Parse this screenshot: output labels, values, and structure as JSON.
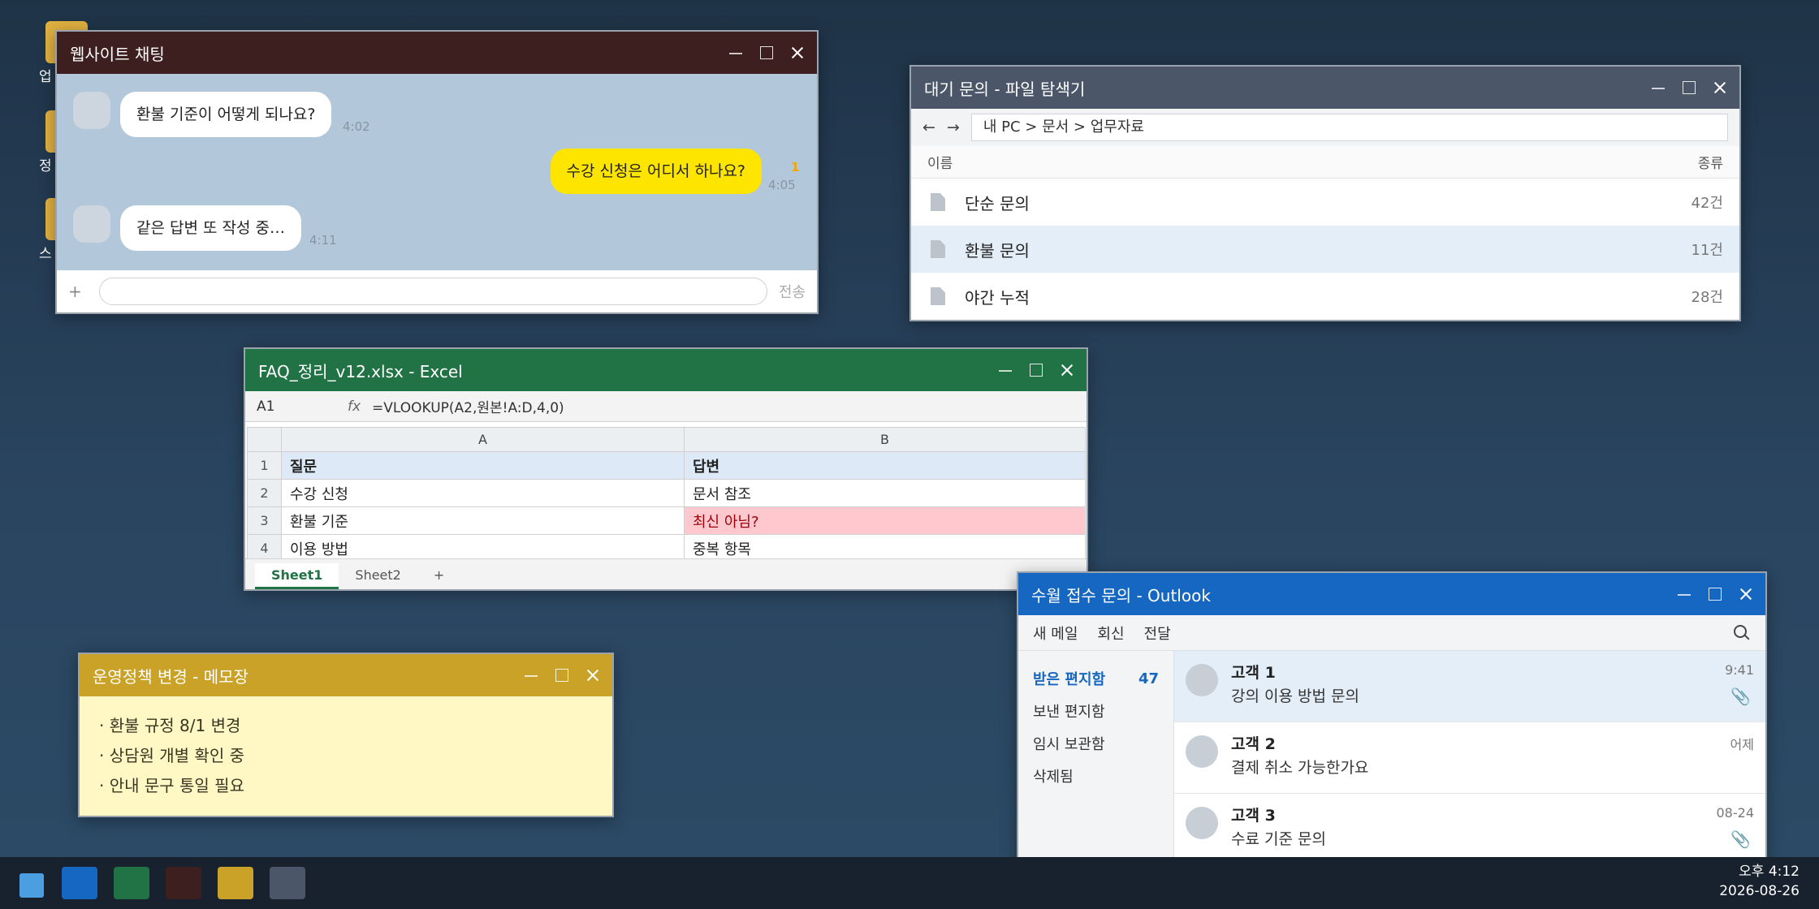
{
  "desktop": {
    "icons": [
      {
        "label": "업"
      },
      {
        "label": "정"
      },
      {
        "label": "스"
      }
    ]
  },
  "chat": {
    "title": "웹사이트 채팅",
    "messages": [
      {
        "side": "left",
        "text": "환불 기준이 어떻게 되나요?",
        "time": "4:02"
      },
      {
        "side": "right",
        "text": "수강 신청은 어디서 하나요?",
        "time": "4:05",
        "unread": "1"
      },
      {
        "side": "left",
        "text": "같은 답변 또 작성 중…",
        "time": "4:11"
      }
    ],
    "input_plus": "+",
    "send_label": "전송"
  },
  "explorer": {
    "title": "대기 문의 - 파일 탐색기",
    "back": "←",
    "forward": "→",
    "path": "내 PC > 문서 > 업무자료",
    "col_name": "이름",
    "col_type": "종류",
    "rows": [
      {
        "name": "단순 문의",
        "count": "42건"
      },
      {
        "name": "환불 문의",
        "count": "11건"
      },
      {
        "name": "야간 누적",
        "count": "28건"
      }
    ]
  },
  "excel": {
    "title": "FAQ_정리_v12.xlsx - Excel",
    "cell_ref": "A1",
    "fx": "fx",
    "formula": "=VLOOKUP(A2,원본!A:D,4,0)",
    "columns": [
      "A",
      "B"
    ],
    "rows": [
      {
        "n": "1",
        "a": "질문",
        "b": "답변"
      },
      {
        "n": "2",
        "a": "수강 신청",
        "b": "문서 참조"
      },
      {
        "n": "3",
        "a": "환불 기준",
        "b": "최신 아님?"
      },
      {
        "n": "4",
        "a": "이용 방법",
        "b": "중복 항목"
      }
    ],
    "sheets": [
      "Sheet1",
      "Sheet2"
    ],
    "add_sheet": "+"
  },
  "memo": {
    "title": "운영정책 변경 - 메모장",
    "lines": [
      "· 환불 규정 8/1 변경",
      "· 상담원 개별 확인 중",
      "· 안내 문구 통일 필요"
    ]
  },
  "outlook": {
    "title": "수월 접수 문의 - Outlook",
    "toolbar": [
      "새 메일",
      "회신",
      "전달"
    ],
    "folders": [
      {
        "label": "받은 편지함",
        "count": "47"
      },
      {
        "label": "보낸 편지함"
      },
      {
        "label": "임시 보관함"
      },
      {
        "label": "삭제됨"
      }
    ],
    "mails": [
      {
        "sender": "고객 1",
        "subject": "강의 이용 방법 문의",
        "time": "9:41",
        "attach": "📎"
      },
      {
        "sender": "고객 2",
        "subject": "결제 취소 가능한가요",
        "time": "어제"
      },
      {
        "sender": "고객 3",
        "subject": "수료 기준 문의",
        "time": "08-24",
        "attach": "📎"
      }
    ]
  },
  "taskbar": {
    "time": "오후 4:12",
    "date": "2026-08-26",
    "colors": [
      "#1667c2",
      "#217346",
      "#3d1f20",
      "#c9a227",
      "#4b5668"
    ]
  }
}
